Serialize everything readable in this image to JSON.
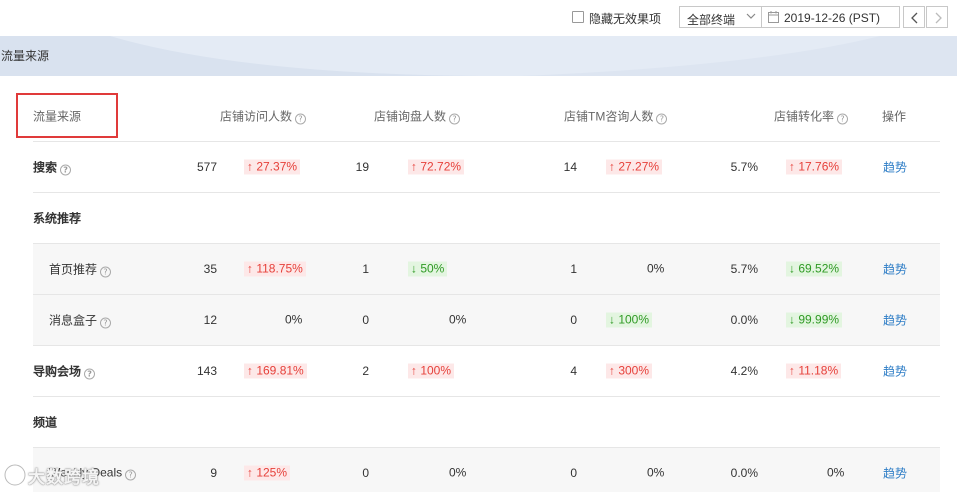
{
  "toolbar": {
    "hide_invalid_label": "隐藏无效果项",
    "terminal_select": "全部终端",
    "date": "2019-12-26 (PST)"
  },
  "banner": {
    "title": "流量来源"
  },
  "table": {
    "headers": {
      "source": "流量来源",
      "visitors": "店铺访问人数",
      "inquiries": "店铺询盘人数",
      "tm_inquiries": "店铺TM咨询人数",
      "conversion": "店铺转化率",
      "action": "操作"
    },
    "rows": [
      {
        "name": "搜索",
        "type": "main",
        "help": true,
        "visitors": "577",
        "visitors_chg": "↑ 27.37%",
        "visitors_dir": "up",
        "inquiries": "19",
        "inquiries_chg": "↑ 72.72%",
        "inquiries_dir": "up",
        "tm": "14",
        "tm_chg": "↑ 27.27%",
        "tm_dir": "up",
        "conv": "5.7%",
        "conv_chg": "↑ 17.76%",
        "conv_dir": "up",
        "action": "趋势"
      },
      {
        "name": "系统推荐",
        "type": "group"
      },
      {
        "name": "首页推荐",
        "type": "sub",
        "help": true,
        "visitors": "35",
        "visitors_chg": "↑ 118.75%",
        "visitors_dir": "up",
        "inquiries": "1",
        "inquiries_chg": "↓ 50%",
        "inquiries_dir": "down",
        "tm": "1",
        "tm_chg": "0%",
        "tm_dir": "flat",
        "conv": "5.7%",
        "conv_chg": "↓ 69.52%",
        "conv_dir": "down",
        "action": "趋势"
      },
      {
        "name": "消息盒子",
        "type": "sub",
        "help": true,
        "visitors": "12",
        "visitors_chg": "0%",
        "visitors_dir": "flat",
        "inquiries": "0",
        "inquiries_chg": "0%",
        "inquiries_dir": "flat",
        "tm": "0",
        "tm_chg": "↓ 100%",
        "tm_dir": "down",
        "conv": "0.0%",
        "conv_chg": "↓ 99.99%",
        "conv_dir": "down",
        "action": "趋势"
      },
      {
        "name": "导购会场",
        "type": "main",
        "help": true,
        "visitors": "143",
        "visitors_chg": "↑ 169.81%",
        "visitors_dir": "up",
        "inquiries": "2",
        "inquiries_chg": "↑ 100%",
        "inquiries_dir": "up",
        "tm": "4",
        "tm_chg": "↑ 300%",
        "tm_dir": "up",
        "conv": "4.2%",
        "conv_chg": "↑ 11.18%",
        "conv_dir": "up",
        "action": "趋势"
      },
      {
        "name": "频道",
        "type": "group"
      },
      {
        "name": "Weekly Deals",
        "type": "sub",
        "help": true,
        "visitors": "9",
        "visitors_chg": "↑ 125%",
        "visitors_dir": "up",
        "inquiries": "0",
        "inquiries_chg": "0%",
        "inquiries_dir": "flat",
        "tm": "0",
        "tm_chg": "0%",
        "tm_dir": "flat",
        "conv": "0.0%",
        "conv_chg": "0%",
        "conv_dir": "flat",
        "action": "趋势"
      }
    ]
  },
  "watermark": {
    "text": "大数跨境"
  },
  "colors": {
    "up": "#e6403a",
    "down": "#2f9a24",
    "link": "#2e7dc6",
    "highlight_box": "#e03a3a"
  }
}
